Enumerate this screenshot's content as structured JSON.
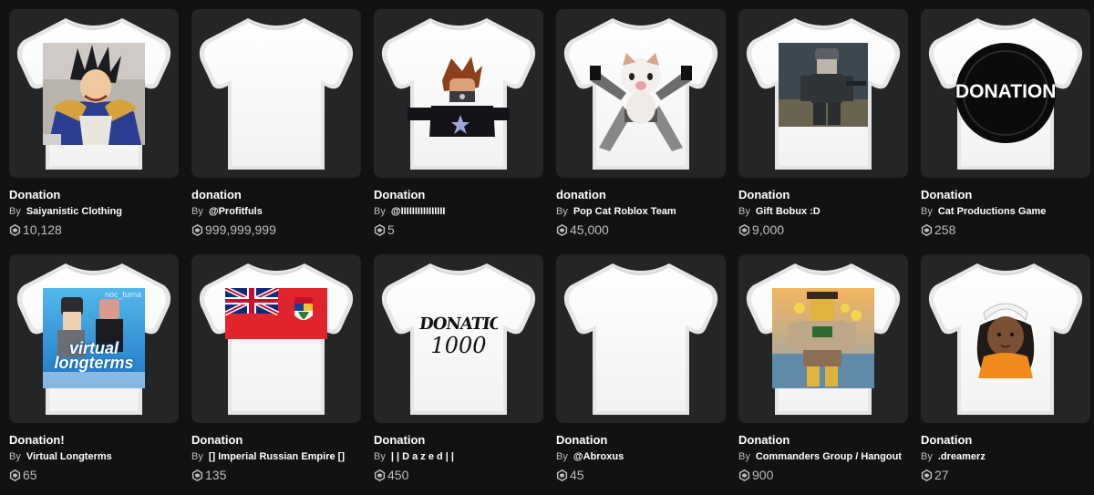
{
  "items": [
    {
      "title": "Donation",
      "by": "By",
      "creator": "Saiyanistic Clothing",
      "price": "10,128",
      "decal": "anime-character"
    },
    {
      "title": "donation",
      "by": "By",
      "creator": "@Profitfuls",
      "price": "999,999,999",
      "decal": "none"
    },
    {
      "title": "Donation",
      "by": "By",
      "creator": "@IIIIIIIIIIIIIIII",
      "price": "5",
      "decal": "avatar"
    },
    {
      "title": "donation",
      "by": "By",
      "creator": "Pop Cat Roblox Team",
      "price": "45,000",
      "decal": "pop-cat"
    },
    {
      "title": "Donation",
      "by": "By",
      "creator": "Gift Bobux :D",
      "price": "9,000",
      "decal": "soldier"
    },
    {
      "title": "Donation",
      "by": "By",
      "creator": "Cat Productions Game",
      "price": "258",
      "decal": "donation-logo",
      "decal_text": "DONATION"
    },
    {
      "title": "Donation!",
      "by": "By",
      "creator": "Virtual Longterms",
      "price": "65",
      "decal": "virtual-longterms",
      "decal_text": "virtual longterms",
      "decal_small": "noc_turna"
    },
    {
      "title": "Donation",
      "by": "By",
      "creator": "[] Imperial Russian Empire []",
      "price": "135",
      "decal": "flag"
    },
    {
      "title": "Donation",
      "by": "By",
      "creator": "| | D a z e d | |",
      "price": "450",
      "decal": "donation-1000",
      "decal_text": "DONATION",
      "decal_small": "1000"
    },
    {
      "title": "Donation",
      "by": "By",
      "creator": "@Abroxus",
      "price": "45",
      "decal": "none"
    },
    {
      "title": "Donation",
      "by": "By",
      "creator": "Commanders Group / Hangout",
      "price": "900",
      "decal": "commander"
    },
    {
      "title": "Donation",
      "by": "By",
      "creator": ".dreamerz",
      "price": "27",
      "decal": "girl"
    }
  ],
  "colors": {
    "background": "#111214",
    "card": "#232527",
    "muted": "#bdbebe"
  },
  "icons": {
    "currency": "robux-icon",
    "item": "tshirt-icon"
  }
}
